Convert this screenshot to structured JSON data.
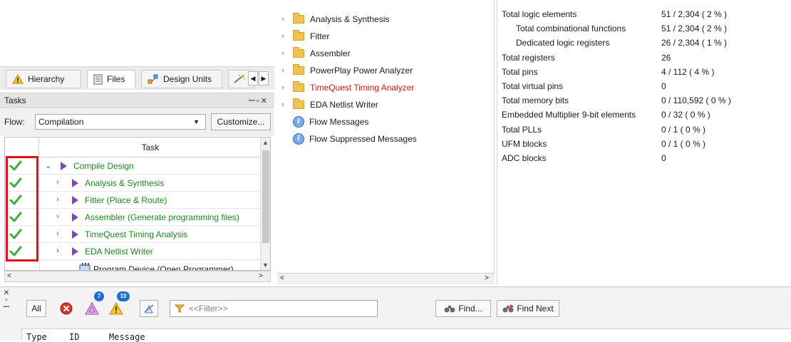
{
  "navigator": {
    "tabs": [
      {
        "label": "Hierarchy",
        "icon": "hierarchy-warning-icon"
      },
      {
        "label": "Files",
        "icon": "files-icon"
      },
      {
        "label": "Design Units",
        "icon": "design-units-icon"
      },
      {
        "label": "",
        "icon": "ip-components-icon"
      }
    ]
  },
  "tasks": {
    "title": "Tasks",
    "flow_label": "Flow:",
    "flow_value": "Compilation",
    "customize_label": "Customize...",
    "column_header": "Task",
    "rows": [
      {
        "label": "Compile Design",
        "status": "done",
        "expanded": true,
        "level": 0
      },
      {
        "label": "Analysis & Synthesis",
        "status": "done",
        "level": 1
      },
      {
        "label": "Fitter (Place & Route)",
        "status": "done",
        "level": 1
      },
      {
        "label": "Assembler (Generate programming files)",
        "status": "done",
        "level": 1
      },
      {
        "label": "TimeQuest Timing Analysis",
        "status": "done",
        "level": 1
      },
      {
        "label": "EDA Netlist Writer",
        "status": "done",
        "level": 1
      }
    ],
    "partial_row": "Program Device (Open Programmer)",
    "highlight_color": "#e0101e"
  },
  "report_tree": {
    "items": [
      {
        "label": "Analysis & Synthesis",
        "type": "folder",
        "color": "#1a1a1a"
      },
      {
        "label": "Fitter",
        "type": "folder",
        "color": "#1a1a1a"
      },
      {
        "label": "Assembler",
        "type": "folder",
        "color": "#1a1a1a"
      },
      {
        "label": "PowerPlay Power Analyzer",
        "type": "folder",
        "color": "#1a1a1a"
      },
      {
        "label": "TimeQuest Timing Analyzer",
        "type": "folder",
        "color": "#e0101e"
      },
      {
        "label": "EDA Netlist Writer",
        "type": "folder",
        "color": "#1a1a1a"
      },
      {
        "label": "Flow Messages",
        "type": "info",
        "color": "#1a1a1a"
      },
      {
        "label": "Flow Suppressed Messages",
        "type": "info",
        "color": "#1a1a1a"
      }
    ]
  },
  "summary": {
    "rows": [
      {
        "key": "Total logic elements",
        "value": "51 / 2,304 ( 2 % )",
        "indent": false
      },
      {
        "key": "Total combinational functions",
        "value": "51 / 2,304 ( 2 % )",
        "indent": true
      },
      {
        "key": "Dedicated logic registers",
        "value": "26 / 2,304 ( 1 % )",
        "indent": true
      },
      {
        "key": "Total registers",
        "value": "26",
        "indent": false
      },
      {
        "key": "Total pins",
        "value": "4 / 112 ( 4 % )",
        "indent": false
      },
      {
        "key": "Total virtual pins",
        "value": "0",
        "indent": false
      },
      {
        "key": "Total memory bits",
        "value": "0 / 110,592 ( 0 % )",
        "indent": false
      },
      {
        "key": "Embedded Multiplier 9-bit elements",
        "value": "0 / 32 ( 0 % )",
        "indent": false
      },
      {
        "key": "Total PLLs",
        "value": "0 / 1 ( 0 % )",
        "indent": false
      },
      {
        "key": "UFM blocks",
        "value": "0 / 1 ( 0 % )",
        "indent": false
      },
      {
        "key": "ADC blocks",
        "value": "0",
        "indent": false
      }
    ]
  },
  "messages": {
    "all_label": "All",
    "critical_count": "7",
    "warning_count": "10",
    "filter_placeholder": "<<Filter>>",
    "find_label": "Find...",
    "find_next_label": "Find Next",
    "columns": [
      "Type",
      "ID",
      "Message"
    ]
  }
}
